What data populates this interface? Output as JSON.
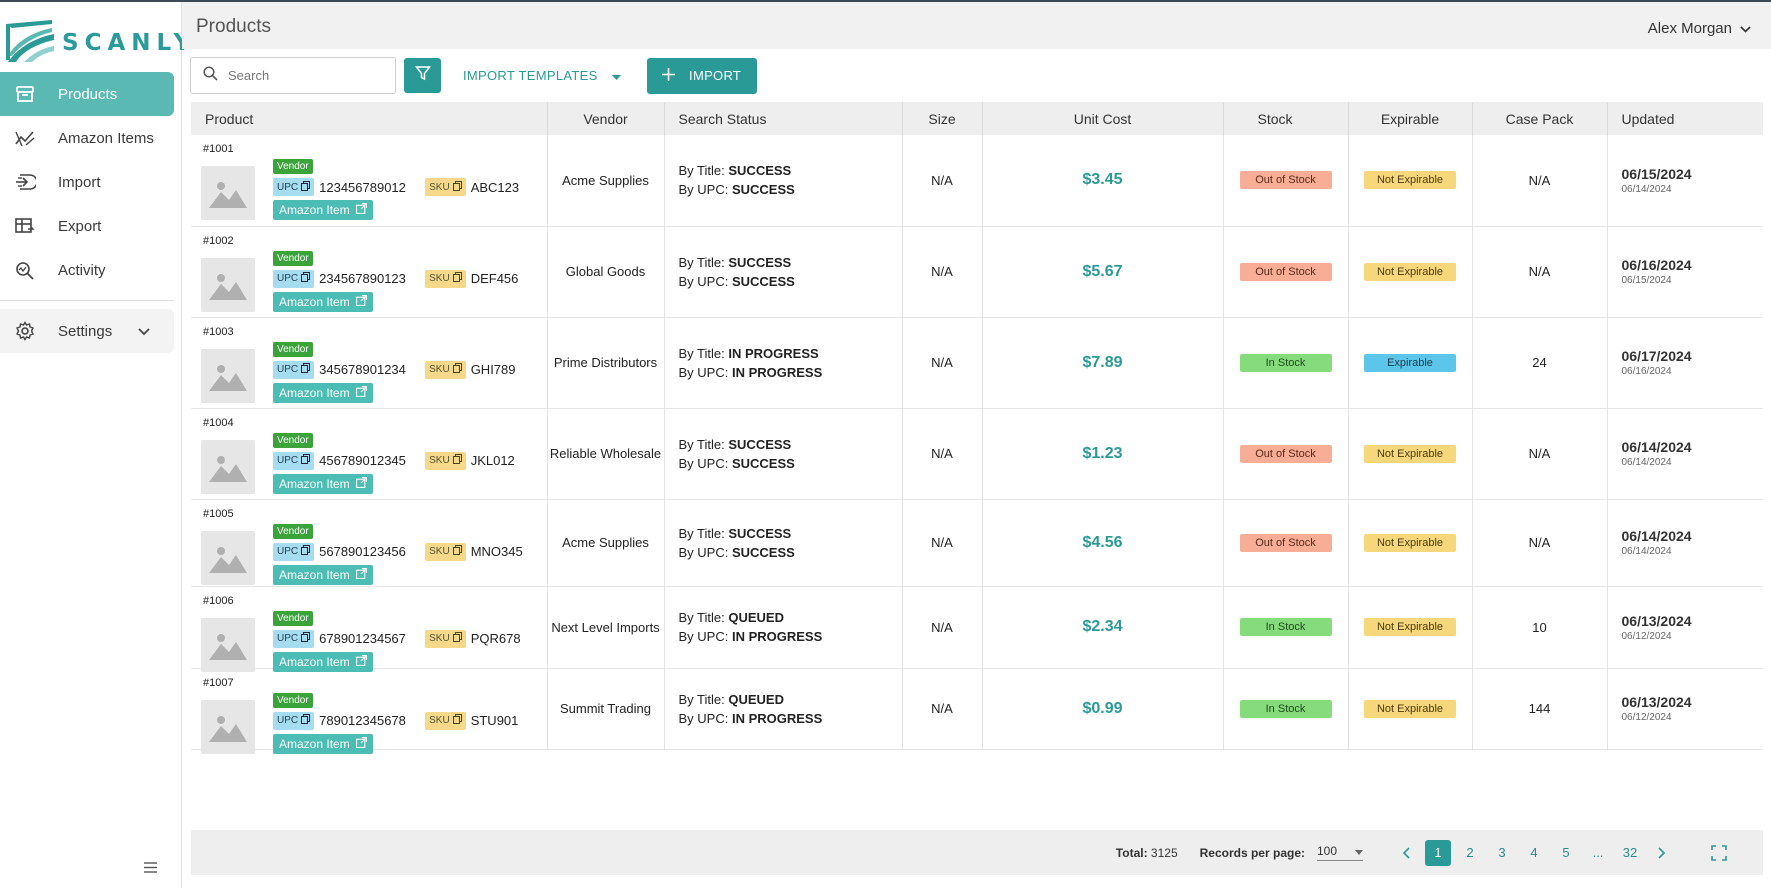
{
  "app": {
    "brand": "SCANLY",
    "accent": "#2a9a96"
  },
  "sidebar": {
    "items": [
      {
        "label": "Products",
        "icon": "archive-icon",
        "active": true
      },
      {
        "label": "Amazon Items",
        "icon": "trend-icon"
      },
      {
        "label": "Import",
        "icon": "import-icon"
      },
      {
        "label": "Export",
        "icon": "export-table-icon"
      },
      {
        "label": "Activity",
        "icon": "search-activity-icon"
      }
    ],
    "settings": {
      "label": "Settings",
      "icon": "gear-icon"
    }
  },
  "header": {
    "title": "Products",
    "user": "Alex Morgan"
  },
  "toolbar": {
    "search_placeholder": "Search",
    "templates_label": "IMPORT TEMPLATES",
    "import_label": "IMPORT"
  },
  "table": {
    "columns": [
      "Product",
      "Vendor",
      "Search Status",
      "Size",
      "Unit Cost",
      "Stock",
      "Expirable",
      "Case Pack",
      "Updated"
    ],
    "rows": [
      {
        "id": "#1001",
        "vendor_badge": "Vendor",
        "upc_label": "UPC",
        "upc": "123456789012",
        "sku_label": "SKU",
        "sku": "ABC123",
        "amazon": "Amazon Item",
        "vendor": "Acme Supplies",
        "title_label": "By Title:",
        "title_status": "SUCCESS",
        "upc_status_label": "By UPC:",
        "upc_status": "SUCCESS",
        "size": "N/A",
        "cost": "$3.45",
        "stock": "Out of Stock",
        "stock_kind": "out",
        "expirable": "Not Expirable",
        "exp_kind": "noexp",
        "case_pack": "N/A",
        "updated": "06/15/2024",
        "created": "06/14/2024"
      },
      {
        "id": "#1002",
        "vendor_badge": "Vendor",
        "upc_label": "UPC",
        "upc": "234567890123",
        "sku_label": "SKU",
        "sku": "DEF456",
        "amazon": "Amazon Item",
        "vendor": "Global Goods",
        "title_label": "By Title:",
        "title_status": "SUCCESS",
        "upc_status_label": "By UPC:",
        "upc_status": "SUCCESS",
        "size": "N/A",
        "cost": "$5.67",
        "stock": "Out of Stock",
        "stock_kind": "out",
        "expirable": "Not Expirable",
        "exp_kind": "noexp",
        "case_pack": "N/A",
        "updated": "06/16/2024",
        "created": "06/15/2024"
      },
      {
        "id": "#1003",
        "vendor_badge": "Vendor",
        "upc_label": "UPC",
        "upc": "345678901234",
        "sku_label": "SKU",
        "sku": "GHI789",
        "amazon": "Amazon Item",
        "vendor": "Prime Distributors",
        "title_label": "By Title:",
        "title_status": "IN PROGRESS",
        "upc_status_label": "By UPC:",
        "upc_status": "IN PROGRESS",
        "size": "N/A",
        "cost": "$7.89",
        "stock": "In Stock",
        "stock_kind": "in",
        "expirable": "Expirable",
        "exp_kind": "exp",
        "case_pack": "24",
        "updated": "06/17/2024",
        "created": "06/16/2024"
      },
      {
        "id": "#1004",
        "vendor_badge": "Vendor",
        "upc_label": "UPC",
        "upc": "456789012345",
        "sku_label": "SKU",
        "sku": "JKL012",
        "amazon": "Amazon Item",
        "vendor": "Reliable Wholesale",
        "title_label": "By Title:",
        "title_status": "SUCCESS",
        "upc_status_label": "By UPC:",
        "upc_status": "SUCCESS",
        "size": "N/A",
        "cost": "$1.23",
        "stock": "Out of Stock",
        "stock_kind": "out",
        "expirable": "Not Expirable",
        "exp_kind": "noexp",
        "case_pack": "N/A",
        "updated": "06/14/2024",
        "created": "06/14/2024"
      },
      {
        "id": "#1005",
        "vendor_badge": "Vendor",
        "upc_label": "UPC",
        "upc": "567890123456",
        "sku_label": "SKU",
        "sku": "MNO345",
        "amazon": "Amazon Item",
        "vendor": "Acme Supplies",
        "title_label": "By Title:",
        "title_status": "SUCCESS",
        "upc_status_label": "By UPC:",
        "upc_status": "SUCCESS",
        "size": "N/A",
        "cost": "$4.56",
        "stock": "Out of Stock",
        "stock_kind": "out",
        "expirable": "Not Expirable",
        "exp_kind": "noexp",
        "case_pack": "N/A",
        "updated": "06/14/2024",
        "created": "06/14/2024"
      },
      {
        "id": "#1006",
        "vendor_badge": "Vendor",
        "upc_label": "UPC",
        "upc": "678901234567",
        "sku_label": "SKU",
        "sku": "PQR678",
        "amazon": "Amazon Item",
        "vendor": "Next Level Imports",
        "title_label": "By Title:",
        "title_status": "QUEUED",
        "upc_status_label": "By UPC:",
        "upc_status": "IN PROGRESS",
        "size": "N/A",
        "cost": "$2.34",
        "stock": "In Stock",
        "stock_kind": "in",
        "expirable": "Not Expirable",
        "exp_kind": "noexp",
        "case_pack": "10",
        "updated": "06/13/2024",
        "created": "06/12/2024"
      },
      {
        "id": "#1007",
        "vendor_badge": "Vendor",
        "upc_label": "UPC",
        "upc": "789012345678",
        "sku_label": "SKU",
        "sku": "STU901",
        "amazon": "Amazon Item",
        "vendor": "Summit Trading",
        "title_label": "By Title:",
        "title_status": "QUEUED",
        "upc_status_label": "By UPC:",
        "upc_status": "IN PROGRESS",
        "size": "N/A",
        "cost": "$0.99",
        "stock": "In Stock",
        "stock_kind": "in",
        "expirable": "Not Expirable",
        "exp_kind": "noexp",
        "case_pack": "144",
        "updated": "06/13/2024",
        "created": "06/12/2024"
      }
    ]
  },
  "footer": {
    "total_label": "Total:",
    "total": "3125",
    "rpp_label": "Records per page:",
    "rpp": "100",
    "pages": [
      "1",
      "2",
      "3",
      "4",
      "5",
      "...",
      "32"
    ],
    "current_page": "1"
  }
}
